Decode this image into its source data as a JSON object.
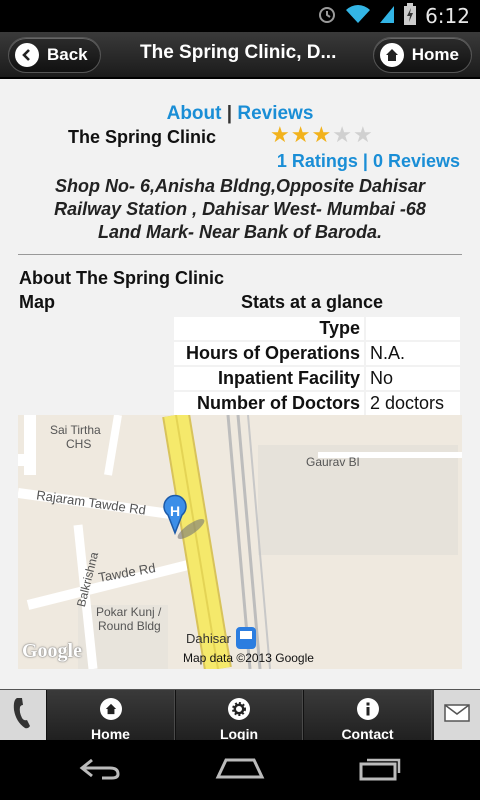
{
  "status_bar": {
    "time": "6:12",
    "icons": [
      "alarm-icon",
      "wifi-icon",
      "signal-icon",
      "battery-charging-icon"
    ]
  },
  "header": {
    "back_label": "Back",
    "title": "The Spring Clinic, D...",
    "home_label": "Home"
  },
  "clinic": {
    "about_link": "About",
    "link_separator": "|",
    "reviews_link": "Reviews",
    "name": "The Spring Clinic",
    "rating_stars": 3,
    "rating_max": 5,
    "ratings_text": "1 Ratings",
    "ratings_separator": "|",
    "reviews_text": "0 Reviews",
    "address_lines": [
      "Shop No- 6,Anisha Bldng,Opposite Dahisar",
      "Railway Station , Dahisar West- Mumbai -68",
      "Land Mark- Near Bank of Baroda."
    ]
  },
  "sections": {
    "about_heading": "About The Spring Clinic",
    "map_heading": "Map",
    "stats_heading": "Stats at a glance"
  },
  "stats": [
    {
      "label": "Type",
      "value": ""
    },
    {
      "label": "Hours of Operations",
      "value": "N.A."
    },
    {
      "label": "Inpatient Facility",
      "value": "No"
    },
    {
      "label": "Number of Doctors",
      "value": "2 doctors"
    }
  ],
  "map": {
    "labels": {
      "sai_tirtha": "Sai Tirtha",
      "chs": "CHS",
      "gaurav": "Gaurav Bl",
      "rajaram": "Rajaram Tawde Rd",
      "tawde": "Tawde Rd",
      "balkrishna": "Balkrishna",
      "pokar": "Pokar Kunj /",
      "round_bldg": "Round Bldg",
      "dahisar": "Dahisar",
      "marker": "H"
    },
    "attribution": "Map data ©2013 Google",
    "logo": "Google"
  },
  "tabbar": {
    "home": "Home",
    "login": "Login",
    "contact": "Contact"
  },
  "colors": {
    "link": "#1a8ed6",
    "star_on": "#f2b21c",
    "star_off": "#d0d0d0",
    "highway": "#f5e96b"
  }
}
